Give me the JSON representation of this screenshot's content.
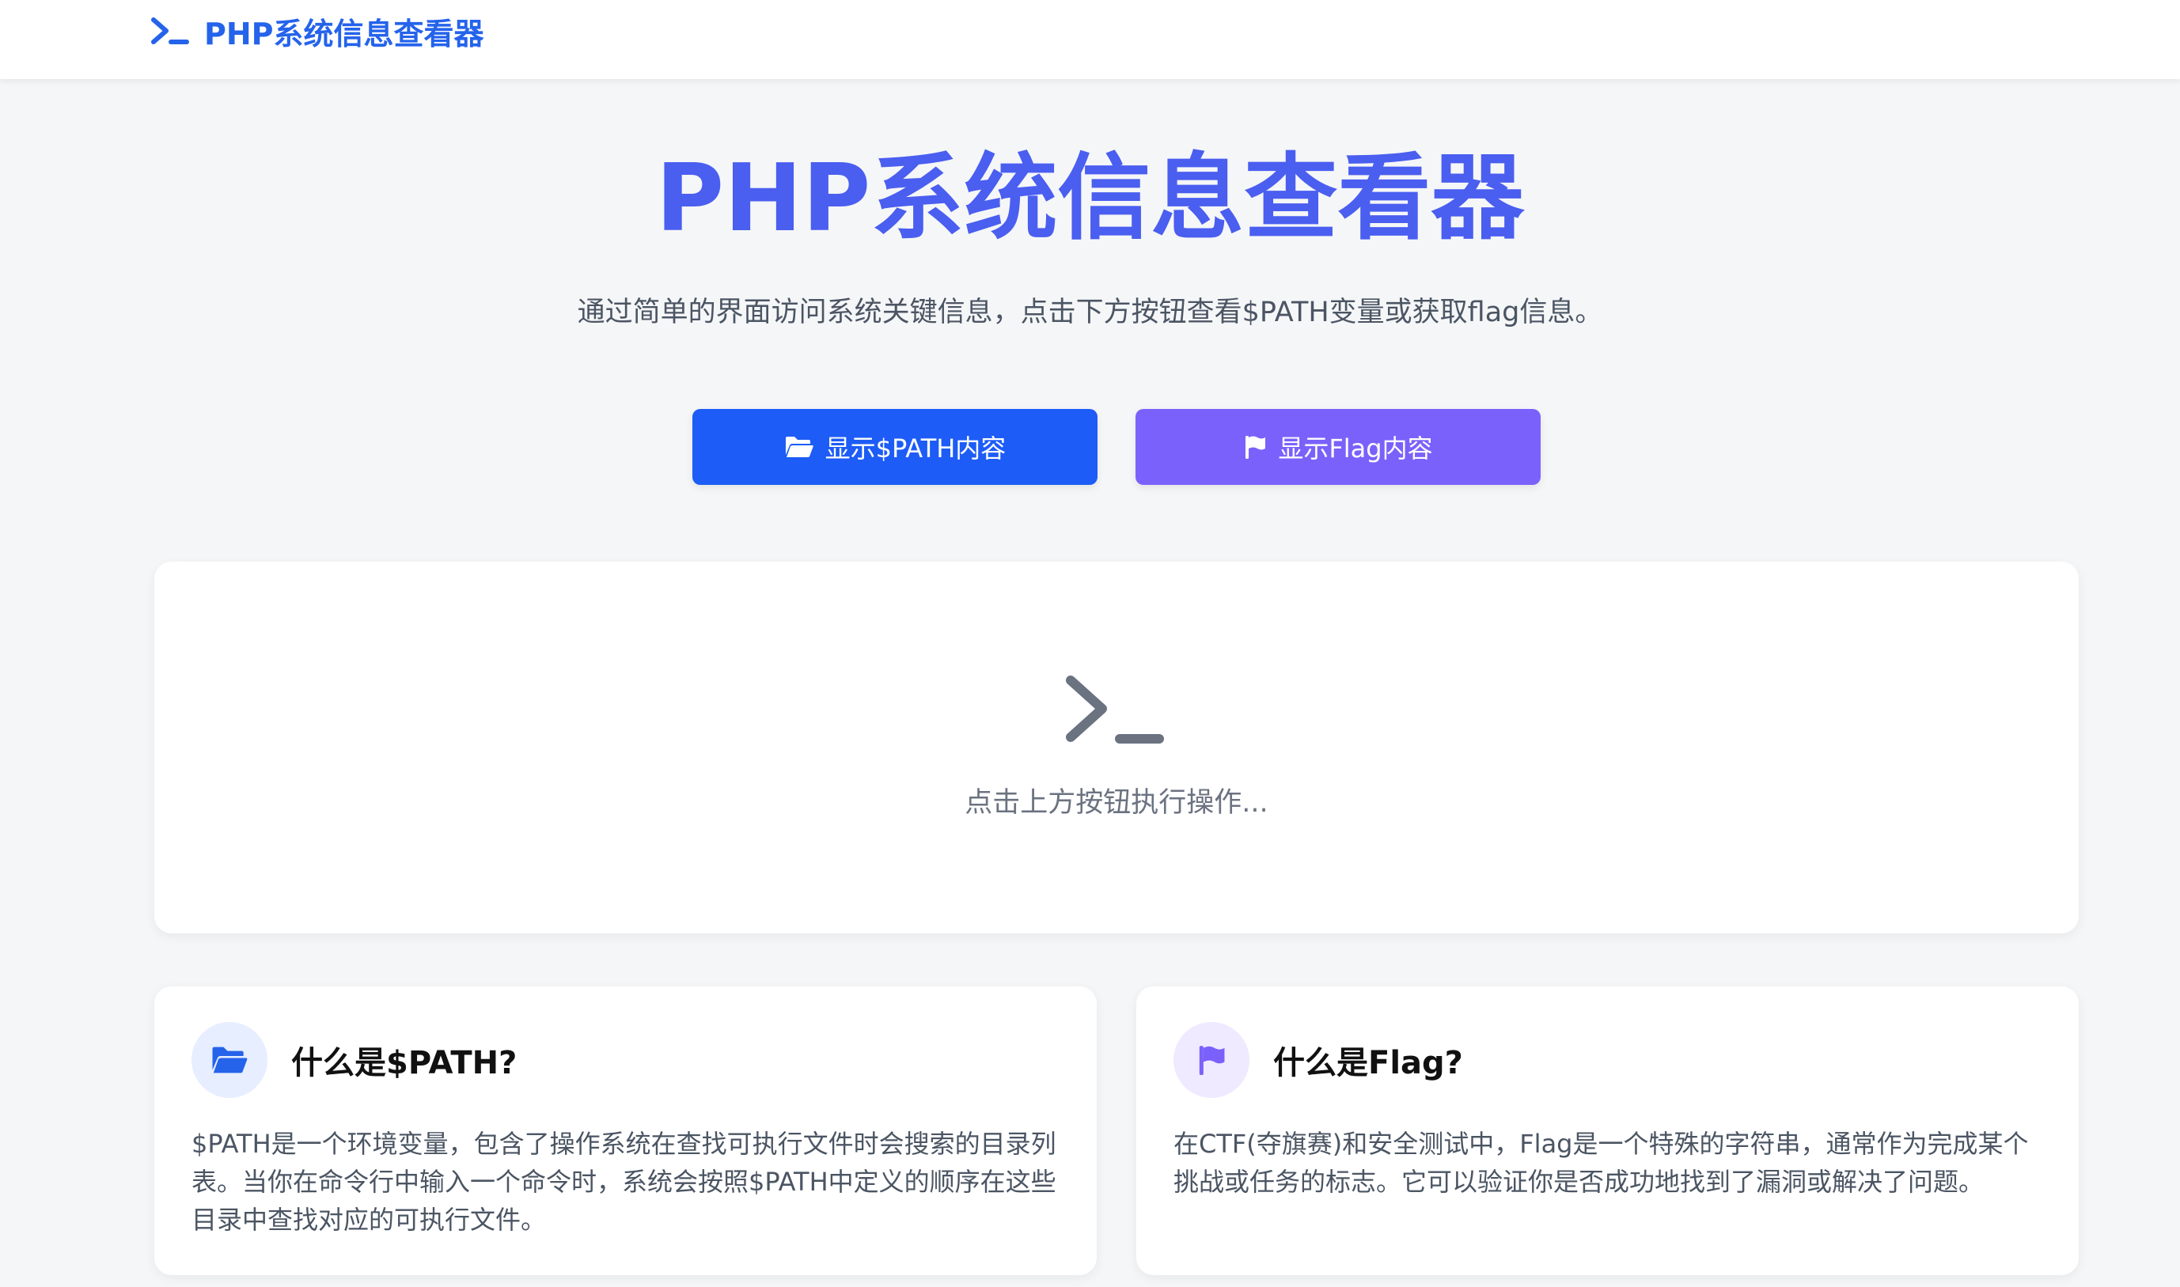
{
  "navbar": {
    "brand": "PHP系统信息查看器"
  },
  "hero": {
    "title": "PHP系统信息查看器",
    "subtitle": "通过简单的界面访问系统关键信息，点击下方按钮查看$PATH变量或获取flag信息。"
  },
  "buttons": {
    "path_label": "显示$PATH内容",
    "flag_label": "显示Flag内容"
  },
  "output": {
    "placeholder": "点击上方按钮执行操作..."
  },
  "cards": {
    "path": {
      "title": "什么是$PATH?",
      "body": "$PATH是一个环境变量，包含了操作系统在查找可执行文件时会搜索的目录列表。当你在命令行中输入一个命令时，系统会按照$PATH中定义的顺序在这些目录中查找对应的可执行文件。"
    },
    "flag": {
      "title": "什么是Flag?",
      "body": "在CTF(夺旗赛)和安全测试中，Flag是一个特殊的字符串，通常作为完成某个挑战或任务的标志。它可以验证你是否成功地找到了漏洞或解决了问题。"
    }
  },
  "icons": {
    "brand": "terminal-icon",
    "path": "folder-open-icon",
    "flag": "flag-icon",
    "output": "terminal-icon"
  },
  "colors": {
    "brand": "#2563eb",
    "title": "#4a5ef0",
    "path_button": "#1d5cf6",
    "flag_button": "#7b61fb"
  }
}
